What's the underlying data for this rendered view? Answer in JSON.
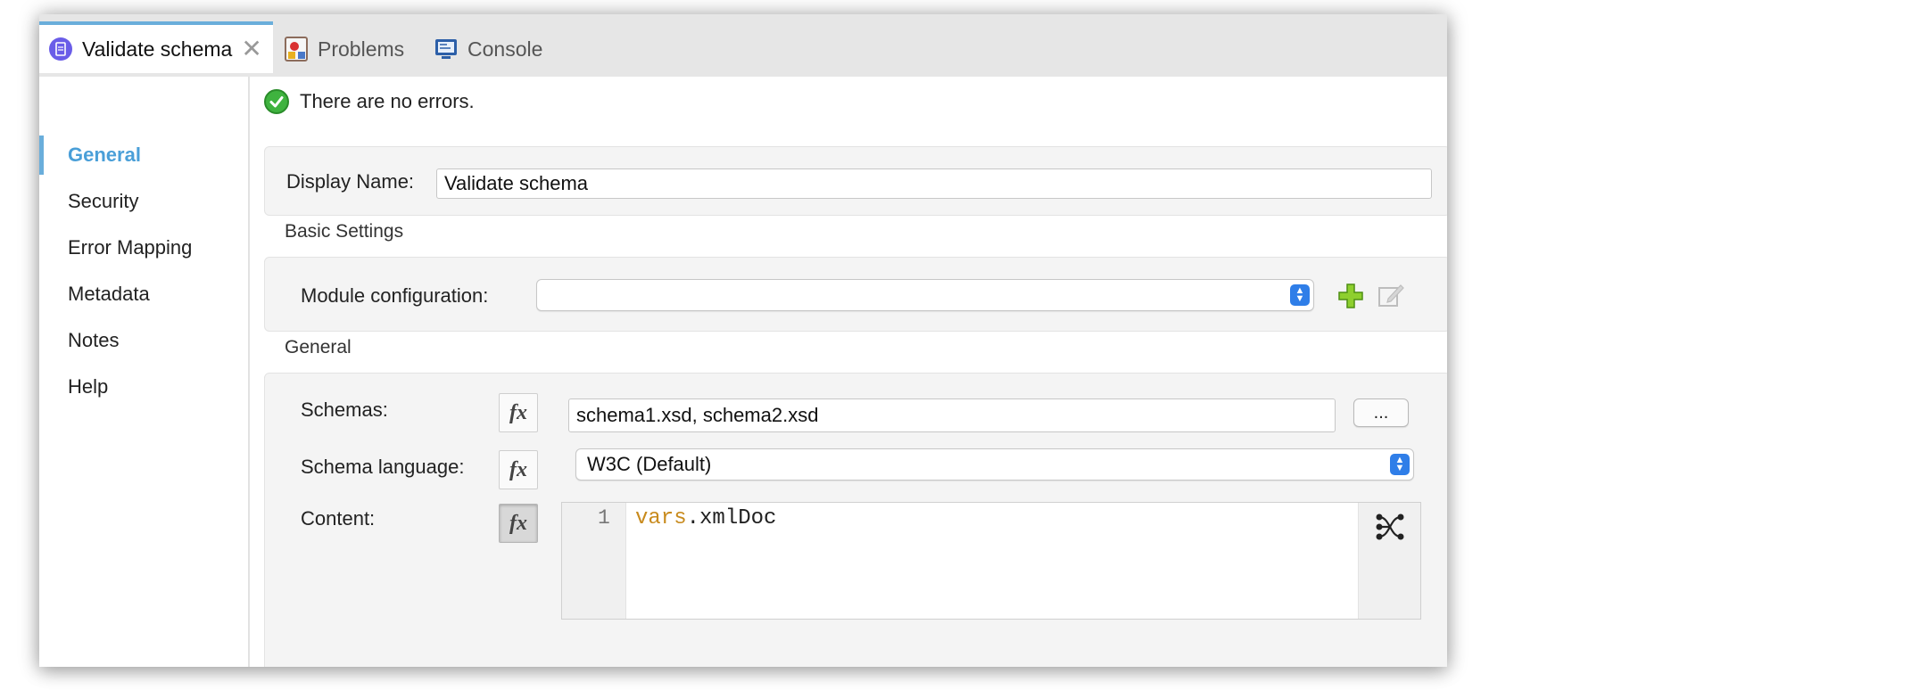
{
  "tabs": [
    {
      "label": "Validate schema",
      "icon": "doc-icon",
      "active": true
    },
    {
      "label": "Problems",
      "icon": "problems-icon"
    },
    {
      "label": "Console",
      "icon": "console-icon"
    }
  ],
  "sidebar": {
    "items": [
      {
        "label": "General",
        "active": true
      },
      {
        "label": "Security"
      },
      {
        "label": "Error Mapping"
      },
      {
        "label": "Metadata"
      },
      {
        "label": "Notes"
      },
      {
        "label": "Help"
      }
    ]
  },
  "status": {
    "text": "There are no errors."
  },
  "display_name": {
    "label": "Display Name:",
    "value": "Validate schema"
  },
  "basic_settings": {
    "title": "Basic Settings",
    "module_label": "Module configuration:",
    "module_value": ""
  },
  "general": {
    "title": "General",
    "schemas_label": "Schemas:",
    "schemas_value": "schema1.xsd, schema2.xsd",
    "browse_label": "...",
    "fx_label": "fx",
    "language_label": "Schema language:",
    "language_value": "W3C (Default)",
    "content_label": "Content:",
    "content_line": "1",
    "content_keyword": "vars",
    "content_rest": ".xmlDoc"
  },
  "colors": {
    "accent": "#6aaedb",
    "select_arrow": "#2f7ee8",
    "ok": "#3fb33f",
    "keyword": "#c88a1c"
  }
}
